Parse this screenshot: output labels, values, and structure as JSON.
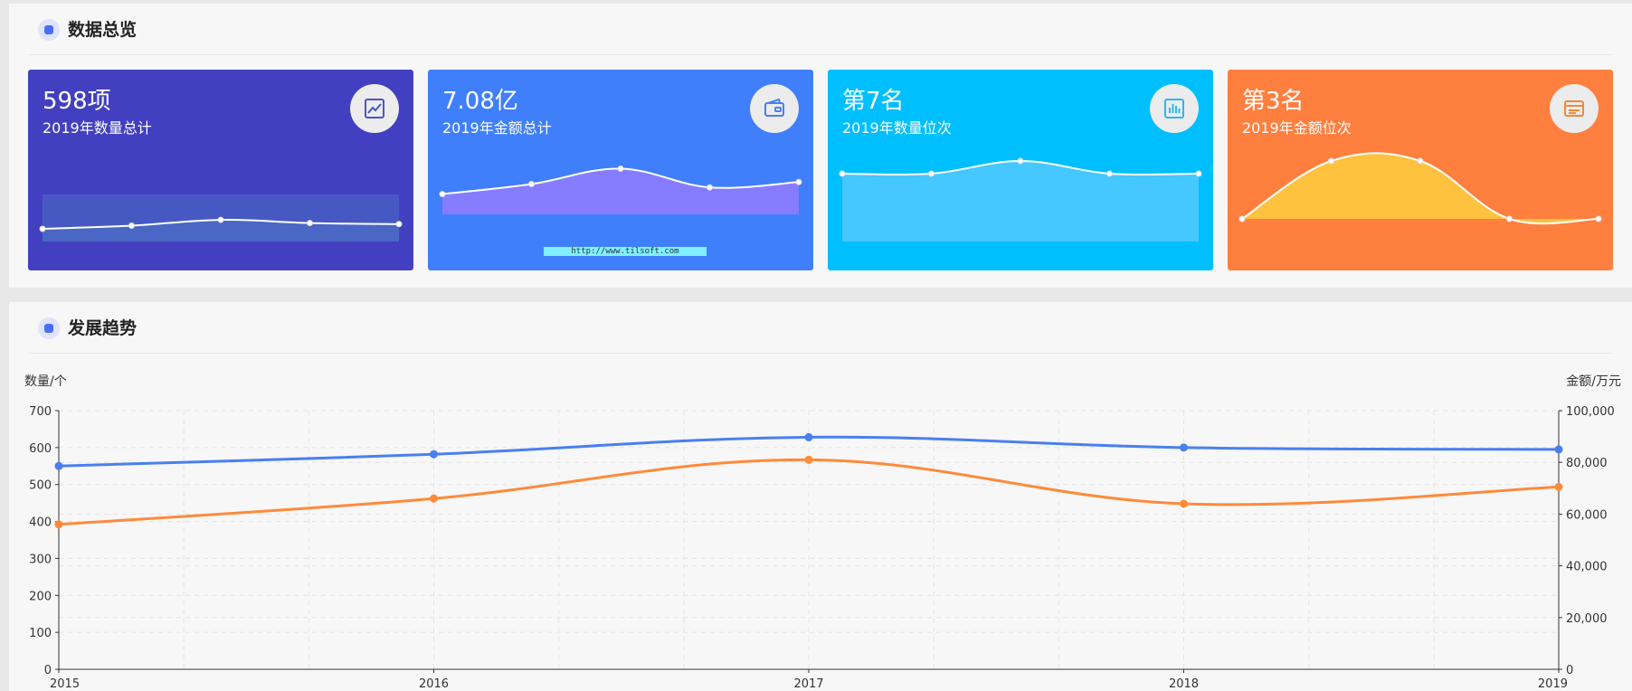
{
  "overview": {
    "title": "数据总览",
    "cards": [
      {
        "value": "598项",
        "subtitle": "2019年数量总计",
        "icon": "trend-chart-icon",
        "color": "#4240c0",
        "spark": [
          24,
          30,
          41,
          35,
          33
        ],
        "style": "area-flat"
      },
      {
        "value": "7.08亿",
        "subtitle": "2019年金额总计",
        "icon": "wallet-icon",
        "color": "#3f7ffc",
        "spark": [
          20,
          35,
          58,
          30,
          38
        ],
        "style": "area"
      },
      {
        "value": "第7名",
        "subtitle": "2019年数量位次",
        "icon": "bar-chart-icon",
        "color": "#00bffe",
        "spark": [
          7,
          7,
          9,
          7,
          7
        ],
        "style": "area-rank"
      },
      {
        "value": "第3名",
        "subtitle": "2019年金额位次",
        "icon": "card-icon",
        "color": "#ff7f3f",
        "spark": [
          1,
          3,
          3,
          1,
          1
        ],
        "style": "area-rank"
      }
    ],
    "watermark": "http://www.tilsoft.com"
  },
  "trend": {
    "title": "发展趋势",
    "chart_data": {
      "type": "line",
      "x": [
        "2015",
        "2016",
        "2017",
        "2018",
        "2019"
      ],
      "y_left": {
        "label": "数量/个",
        "range": [
          0,
          700
        ],
        "ticks": [
          "0",
          "100",
          "200",
          "300",
          "400",
          "500",
          "600",
          "700"
        ]
      },
      "y_right": {
        "label": "金额/万元",
        "range": [
          0,
          100000
        ],
        "ticks": [
          "0",
          "20,000",
          "40,000",
          "60,000",
          "80,000",
          "100,000"
        ]
      },
      "series": [
        {
          "axis": "left",
          "color": "#4a7ff0",
          "values": [
            550,
            582,
            628,
            600,
            595
          ]
        },
        {
          "axis": "right",
          "color": "#ff8a3a",
          "values": [
            56000,
            66000,
            81000,
            64000,
            70500
          ]
        }
      ],
      "grid": true
    }
  }
}
